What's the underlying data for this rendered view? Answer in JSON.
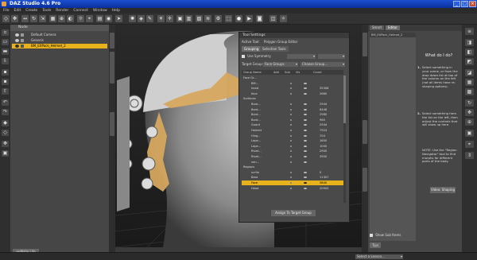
{
  "window": {
    "title": "DAZ Studio 4.6 Pro",
    "min": "_",
    "max": "□",
    "close": "×"
  },
  "menu": [
    "File",
    "Edit",
    "Create",
    "Tools",
    "Render",
    "Connect",
    "Window",
    "Help"
  ],
  "scene": {
    "header": "Node",
    "rows": [
      {
        "label": "Default Camera",
        "selected": false
      },
      {
        "label": "Genesis",
        "selected": false
      },
      {
        "label": "BM_EXPack_Helmet_2",
        "selected": true
      }
    ],
    "bottom_tab": "enMalle Life"
  },
  "tool_settings": {
    "title": "Tool Settings",
    "active_tool_label": "Active Tool:",
    "active_tool": "Polygon Group Editor",
    "tabs": [
      "Grouping",
      "Selection Tools"
    ],
    "symmetry_label": "Use Symmetry",
    "target_group_label": "Target Group:",
    "target_group_value": "Face Groups",
    "choose_group": "Choose Group...",
    "columns": [
      "Group Name",
      "Add",
      "Sub",
      "Vis",
      "Count"
    ],
    "sections": {
      "face": "Face Gr...",
      "surfaces": "Surfaces",
      "regions": "Regions"
    },
    "face_groups": [
      {
        "name": "BM...",
        "count": ""
      },
      {
        "name": "head",
        "count": "35306"
      },
      {
        "name": "face",
        "count": "2660"
      }
    ],
    "surface_groups": [
      {
        "name": "Boro...",
        "count": "2944"
      },
      {
        "name": "Bord...",
        "count": "8448"
      },
      {
        "name": "Bord...",
        "count": "2980"
      },
      {
        "name": "Bord...",
        "count": "960"
      },
      {
        "name": "Guard",
        "count": "2944"
      },
      {
        "name": "Helmet",
        "count": "7924"
      },
      {
        "name": "Hing...",
        "count": "704"
      },
      {
        "name": "Lape...",
        "count": "1600"
      },
      {
        "name": "Lape...",
        "count": "1000"
      },
      {
        "name": "Rivet...",
        "count": "2900"
      },
      {
        "name": "Rivet...",
        "count": "3900"
      },
      {
        "name": "ven...",
        "count": ""
      }
    ],
    "region_groups": [
      {
        "name": "scr9e",
        "count": "0",
        "highlight": false
      },
      {
        "name": "Bara",
        "count": "11307",
        "highlight": false
      },
      {
        "name": "Face",
        "count": "5840",
        "highlight": true
      },
      {
        "name": "Head",
        "count": "20900",
        "highlight": false
      }
    ],
    "assign_button": "Assign To Target Group"
  },
  "right_panel": {
    "tabs": [
      "Smart",
      "Editor"
    ],
    "nav_title": "BM_EXPack_Helmet_2",
    "question": "What do I do?",
    "help": [
      {
        "num": "1.",
        "text": "Select something in your scene, or from the drop down list at top of the column on the left (not all items have re-shaping options)."
      },
      {
        "num": "2.",
        "text": "Select something from the list on the left, then adjust the controls that will show up here."
      },
      {
        "num": "",
        "text": "NOTE: Use the \"Region Navigator\" tool to find morphs for different parts of the body."
      }
    ],
    "video_button": "Video: Shaping",
    "show_sub_items": "Show Sub Items",
    "tips_tab": "Tips"
  },
  "status": {
    "lesson": "Select a Lesson..."
  }
}
